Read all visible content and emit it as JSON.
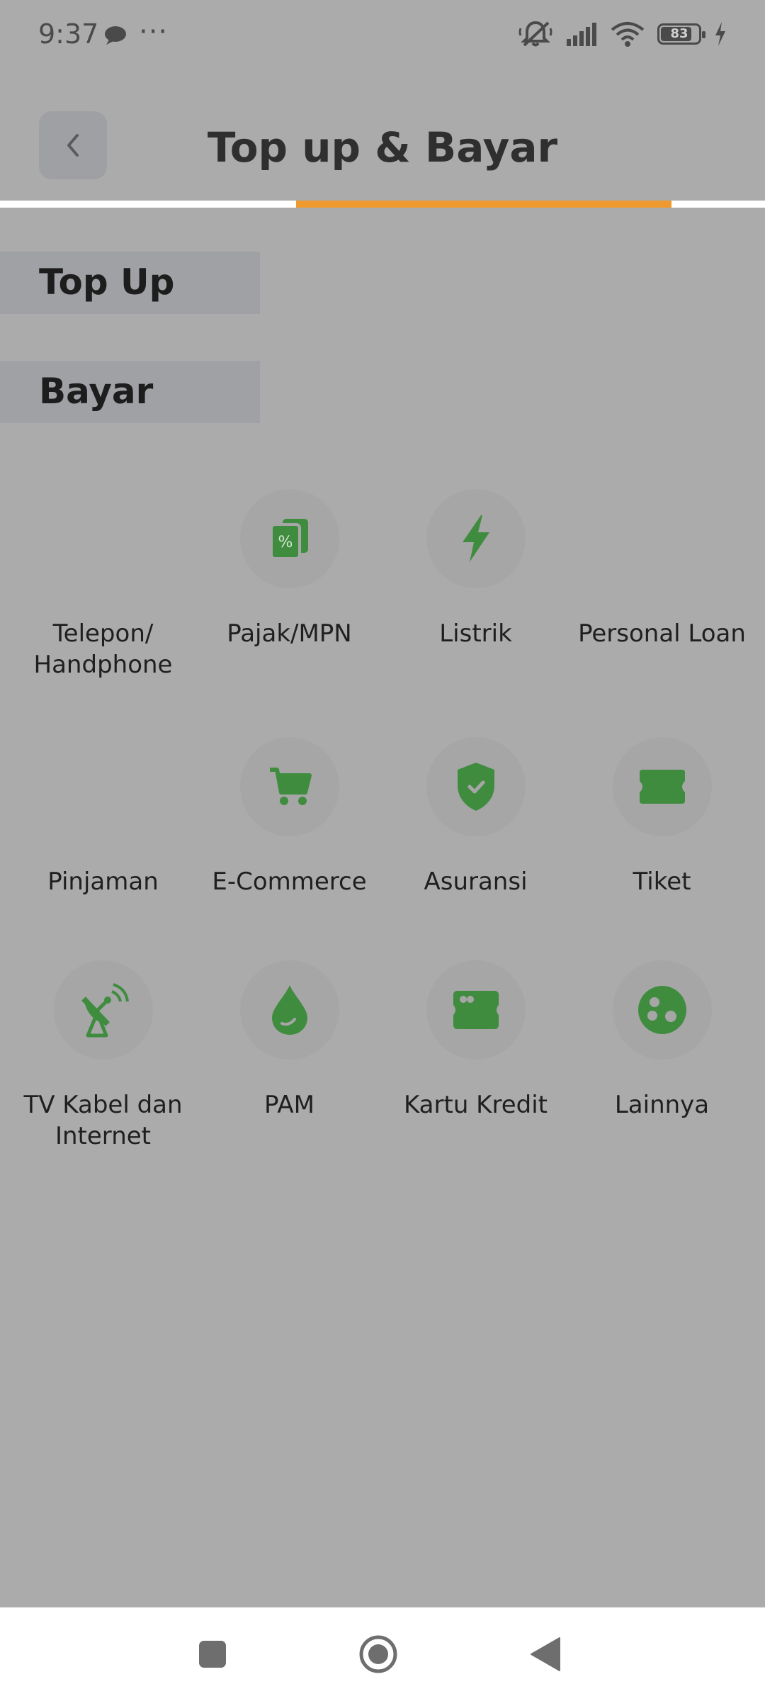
{
  "status": {
    "time": "9:37",
    "dots": "···",
    "battery": "83"
  },
  "header": {
    "title": "Top up & Bayar",
    "progress": 0.49
  },
  "tabs": [
    {
      "label": "Top Up"
    },
    {
      "label": "Bayar"
    }
  ],
  "items": [
    {
      "label": "Telepon/ Handphone",
      "icon": "phone-icon"
    },
    {
      "label": "Pajak/MPN",
      "icon": "tax-receipt-icon"
    },
    {
      "label": "Listrik",
      "icon": "lightning-icon"
    },
    {
      "label": "Personal Loan",
      "icon": "loan-icon"
    },
    {
      "label": "Pinjaman",
      "icon": "loan-icon"
    },
    {
      "label": "E-Commerce",
      "icon": "cart-icon"
    },
    {
      "label": "Asuransi",
      "icon": "shield-icon"
    },
    {
      "label": "Tiket",
      "icon": "ticket-icon"
    },
    {
      "label": "TV Kabel dan Internet",
      "icon": "satellite-dish-icon"
    },
    {
      "label": "PAM",
      "icon": "water-drop-icon"
    },
    {
      "label": "Kartu Kredit",
      "icon": "credit-card-icon"
    },
    {
      "label": "Lainnya",
      "icon": "more-dots-icon"
    }
  ],
  "colors": {
    "icon": "#3f8c3f",
    "accent": "#ee9a2e",
    "overlay": "#ababab"
  }
}
